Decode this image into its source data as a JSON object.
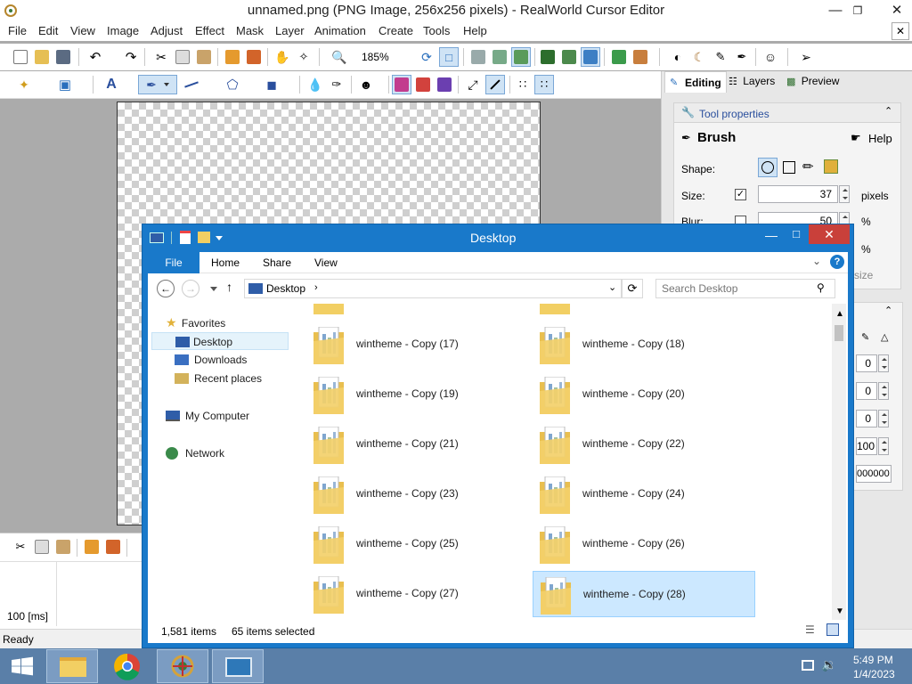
{
  "editor": {
    "title": "unnamed.png (PNG Image, 256x256 pixels) - RealWorld Cursor Editor",
    "menu": [
      "File",
      "Edit",
      "View",
      "Image",
      "Adjust",
      "Effect",
      "Mask",
      "Layer",
      "Animation",
      "Create",
      "Tools",
      "Help"
    ],
    "zoom": "185%",
    "tabs": {
      "editing": "Editing",
      "layers": "Layers",
      "preview": "Preview"
    },
    "tool_properties": {
      "header": "Tool properties",
      "tool_name": "Brush",
      "help": "Help",
      "shape_label": "Shape:",
      "size_label": "Size:",
      "size_value": "37",
      "size_unit": "pixels",
      "blur_label": "Blur:",
      "blur_value": "50",
      "blur_unit": "%",
      "pct2": "%",
      "partial_label": "size"
    },
    "side_values": [
      "0",
      "0",
      "0",
      "100",
      "000000"
    ],
    "frame_delay": "100 [ms]",
    "status": "Ready"
  },
  "explorer": {
    "title": "Desktop",
    "ribbon": {
      "file": "File",
      "home": "Home",
      "share": "Share",
      "view": "View"
    },
    "address": "Desktop",
    "search_placeholder": "Search Desktop",
    "nav": {
      "favorites": "Favorites",
      "desktop": "Desktop",
      "downloads": "Downloads",
      "recent": "Recent places",
      "computer": "My Computer",
      "network": "Network"
    },
    "files": [
      "wintheme - Copy (17)",
      "wintheme - Copy (18)",
      "wintheme - Copy (19)",
      "wintheme - Copy (20)",
      "wintheme - Copy (21)",
      "wintheme - Copy (22)",
      "wintheme - Copy (23)",
      "wintheme - Copy (24)",
      "wintheme - Copy (25)",
      "wintheme - Copy (26)",
      "wintheme - Copy (27)",
      "wintheme - Copy (28)"
    ],
    "item_count": "1,581 items",
    "selected_count": "65 items selected"
  },
  "taskbar": {
    "time": "5:49 PM",
    "date": "1/4/2023"
  },
  "colors": {
    "accent": "#1979ca",
    "selection": "#cce8ff",
    "taskbar": "#5a7fa8"
  }
}
